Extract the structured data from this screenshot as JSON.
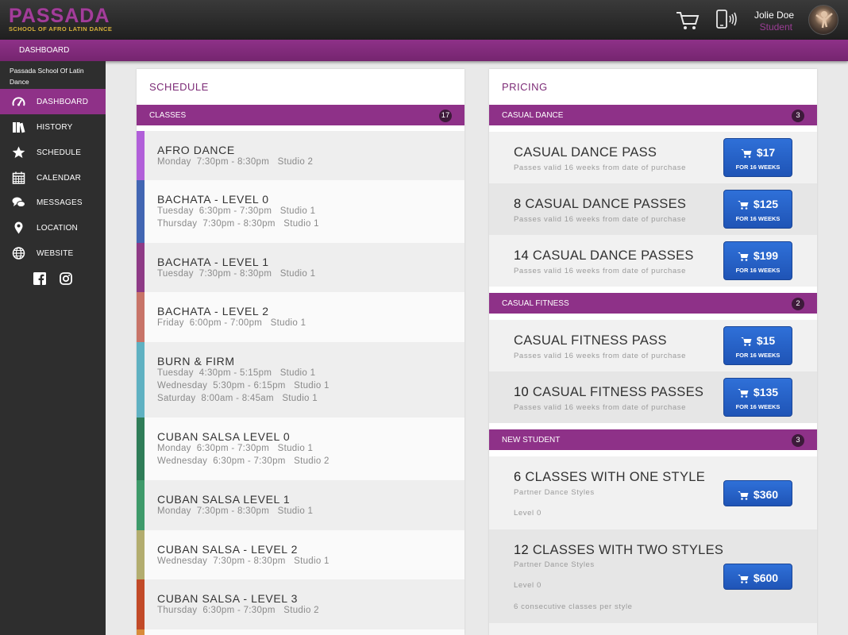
{
  "header": {
    "logo_main": "PASSADA",
    "logo_sub": "SCHOOL OF AFRO LATIN DANCE",
    "user_name": "Jolie Doe",
    "user_role": "Student"
  },
  "navbar": {
    "item": "DASHBOARD"
  },
  "sidebar": {
    "school_name": "Passada School Of Latin Dance",
    "items": [
      {
        "label": "DASHBOARD",
        "icon": "dashboard-icon"
      },
      {
        "label": "HISTORY",
        "icon": "books-icon"
      },
      {
        "label": "SCHEDULE",
        "icon": "star-icon"
      },
      {
        "label": "CALENDAR",
        "icon": "calendar-icon"
      },
      {
        "label": "MESSAGES",
        "icon": "chat-icon"
      },
      {
        "label": "LOCATION",
        "icon": "map-pin-icon"
      },
      {
        "label": "WEBSITE",
        "icon": "globe-icon"
      }
    ]
  },
  "schedule": {
    "title": "SCHEDULE",
    "section_label": "CLASSES",
    "count": "17",
    "classes": [
      {
        "name": "AFRO DANCE",
        "color": "#b15fd9",
        "lines": [
          "Monday  7:30pm - 8:30pm   Studio 2"
        ]
      },
      {
        "name": "BACHATA - LEVEL 0",
        "color": "#4266b3",
        "lines": [
          "Tuesday  6:30pm - 7:30pm   Studio 1",
          "Thursday  7:30pm - 8:30pm   Studio 1"
        ]
      },
      {
        "name": "BACHATA - LEVEL 1",
        "color": "#8e3a86",
        "lines": [
          "Tuesday  7:30pm - 8:30pm   Studio 1"
        ]
      },
      {
        "name": "BACHATA - LEVEL 2",
        "color": "#c87468",
        "lines": [
          "Friday  6:00pm - 7:00pm   Studio 1"
        ]
      },
      {
        "name": "BURN & FIRM",
        "color": "#5fb1c2",
        "lines": [
          "Tuesday  4:30pm - 5:15pm   Studio 1",
          "Wednesday  5:30pm - 6:15pm   Studio 1",
          "Saturday  8:00am - 8:45am   Studio 1"
        ]
      },
      {
        "name": "CUBAN SALSA LEVEL 0",
        "color": "#2f7d58",
        "lines": [
          "Monday  6:30pm - 7:30pm   Studio 1",
          "Wednesday  6:30pm - 7:30pm   Studio 2"
        ]
      },
      {
        "name": "CUBAN SALSA LEVEL 1",
        "color": "#3e9a6a",
        "lines": [
          "Monday  7:30pm - 8:30pm   Studio 1"
        ]
      },
      {
        "name": "CUBAN SALSA - LEVEL 2",
        "color": "#b3ad6f",
        "lines": [
          "Wednesday  7:30pm - 8:30pm   Studio 1"
        ]
      },
      {
        "name": "CUBAN SALSA - LEVEL 3",
        "color": "#c24a28",
        "lines": [
          "Thursday  6:30pm - 7:30pm   Studio 2"
        ]
      }
    ]
  },
  "pricing": {
    "title": "PRICING",
    "sections": [
      {
        "label": "CASUAL DANCE",
        "count": "3",
        "items": [
          {
            "qty": "",
            "name": "CASUAL DANCE PASS",
            "desc": "Passes valid 16 weeks from date of purchase",
            "price": "$17",
            "sub": "FOR 16 WEEKS"
          },
          {
            "qty": "8",
            "name": "CASUAL DANCE PASSES",
            "desc": "Passes valid 16 weeks from date of purchase",
            "price": "$125",
            "sub": "FOR 16 WEEKS"
          },
          {
            "qty": "14",
            "name": "CASUAL DANCE PASSES",
            "desc": "Passes valid 16 weeks from date of purchase",
            "price": "$199",
            "sub": "FOR 16 WEEKS"
          }
        ]
      },
      {
        "label": "CASUAL FITNESS",
        "count": "2",
        "items": [
          {
            "qty": "",
            "name": "CASUAL FITNESS PASS",
            "desc": "Passes valid 16 weeks from date of purchase",
            "price": "$15",
            "sub": "FOR 16 WEEKS"
          },
          {
            "qty": "10",
            "name": "CASUAL FITNESS PASSES",
            "desc": "Passes valid 16 weeks from date of purchase",
            "price": "$135",
            "sub": "FOR 16 WEEKS"
          }
        ]
      },
      {
        "label": "NEW STUDENT",
        "count": "3",
        "items": [
          {
            "qty": "6",
            "name": "CLASSES WITH ONE STYLE",
            "desc_lines": [
              "Partner Dance Styles",
              "Level 0"
            ],
            "price": "$360"
          },
          {
            "qty": "12",
            "name": "CLASSES WITH TWO STYLES",
            "desc_lines": [
              "Partner Dance Styles",
              "Level 0",
              "6 consecutive classes per style"
            ],
            "price": "$600"
          }
        ]
      }
    ]
  }
}
